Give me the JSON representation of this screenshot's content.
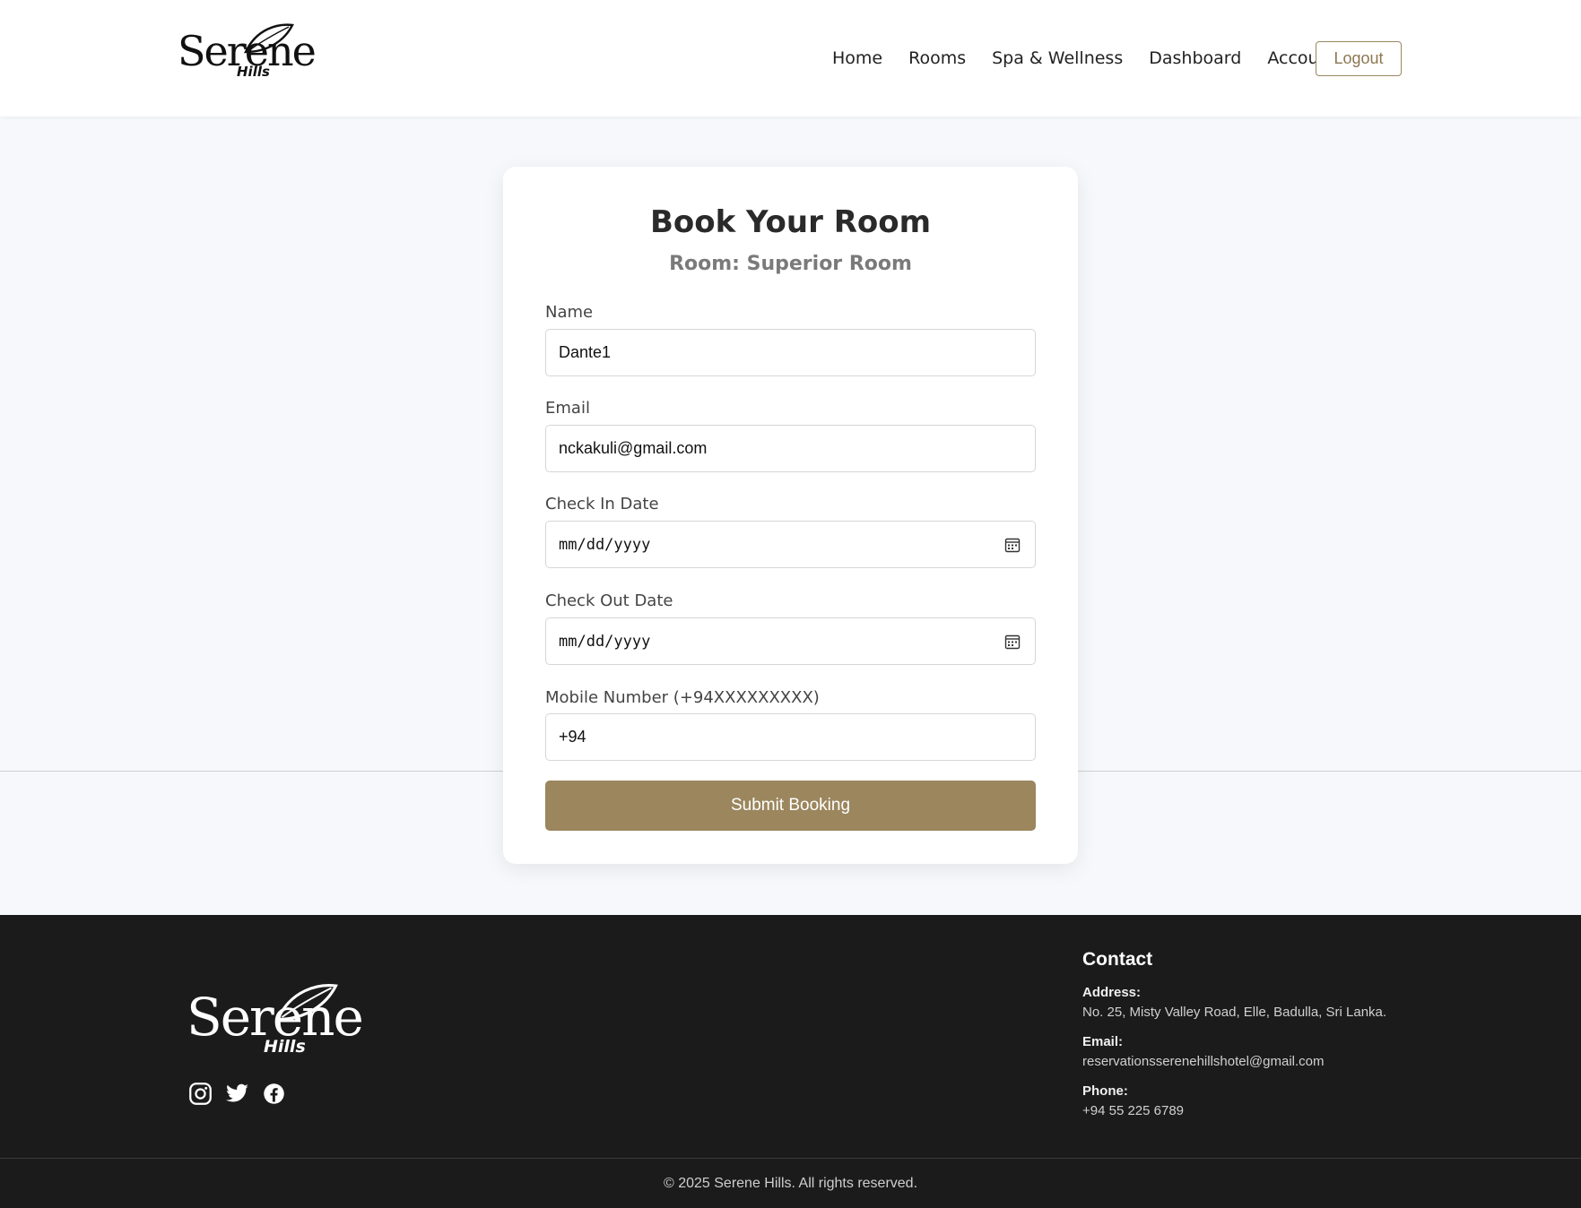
{
  "header": {
    "logo_main": "Serene",
    "logo_sub": "Hills",
    "nav": [
      "Home",
      "Rooms",
      "Spa & Wellness",
      "Dashboard",
      "Account"
    ],
    "logout_label": "Logout"
  },
  "booking": {
    "title": "Book Your Room",
    "room": "Room: Superior Room",
    "fields": {
      "name_label": "Name",
      "name_value": "Dante1",
      "email_label": "Email",
      "email_value": "nckakuli@gmail.com",
      "checkin_label": "Check In Date",
      "checkin_value": "mm/dd/yyyy",
      "checkout_label": "Check Out Date",
      "checkout_value": "mm/dd/yyyy",
      "mobile_label": "Mobile Number (+94XXXXXXXXX)",
      "mobile_value": "+94"
    },
    "submit_label": "Submit Booking"
  },
  "footer": {
    "logo_main": "Serene",
    "logo_sub": "Hills",
    "socials": [
      "instagram-icon",
      "twitter-icon",
      "facebook-icon"
    ],
    "contact_title": "Contact",
    "address_label": "Address:",
    "address_value": "No. 25, Misty Valley Road, Elle, Badulla, Sri Lanka.",
    "email_label": "Email:",
    "email_value": "reservationsserenehillshotel@gmail.com",
    "phone_label": "Phone:",
    "phone_value": "+94 55 225 6789",
    "copyright": "© 2025 Serene Hills. All rights reserved."
  },
  "colors": {
    "accent": "#9b865e",
    "footer_bg": "#1b1b1b",
    "page_bg": "#f6f8fb"
  }
}
